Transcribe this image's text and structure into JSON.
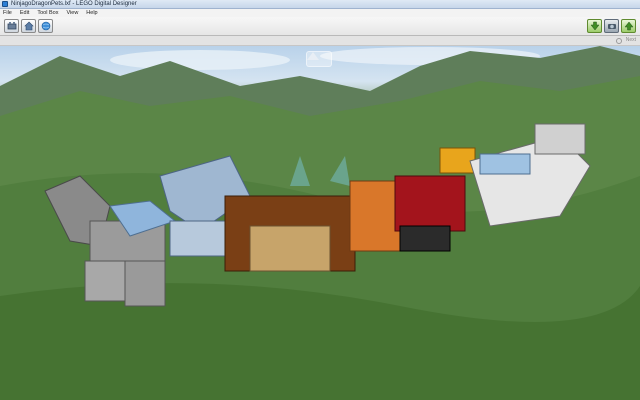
{
  "window": {
    "title": "NinjagoDragonPets.lxf - LEGO Digital Designer"
  },
  "menu": {
    "items": [
      "File",
      "Edit",
      "Tool Box",
      "View",
      "Help"
    ]
  },
  "toolbar": {
    "left_icons": [
      "build-mode-icon",
      "home-icon",
      "globe-icon"
    ],
    "right_icons": [
      "download-icon",
      "camera-icon",
      "upload-icon"
    ]
  },
  "strip": {
    "right_label": "Next"
  },
  "viewport": {
    "nav_arrow_icon": "up-arrow-icon",
    "sky_color": "#c8dbee",
    "terrain_color": "#5a8646"
  }
}
